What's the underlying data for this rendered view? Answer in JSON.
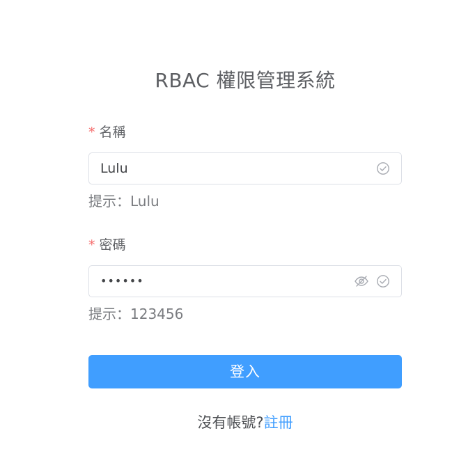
{
  "header": {
    "title": "RBAC 權限管理系統"
  },
  "form": {
    "username": {
      "required_mark": "*",
      "label": "名稱",
      "value": "Lulu",
      "hint": "提示：Lulu",
      "status_icon": "circle-check-icon"
    },
    "password": {
      "required_mark": "*",
      "label": "密碼",
      "value": "••••••",
      "hint": "提示：123456",
      "toggle_icon": "eye-off-icon",
      "status_icon": "circle-check-icon"
    },
    "submit_label": "登入"
  },
  "footer": {
    "prompt": "沒有帳號?",
    "register_link": "註冊"
  },
  "colors": {
    "primary": "#409eff",
    "required": "#f56c6c",
    "border": "#dcdfe6",
    "icon": "#a8abb2"
  }
}
